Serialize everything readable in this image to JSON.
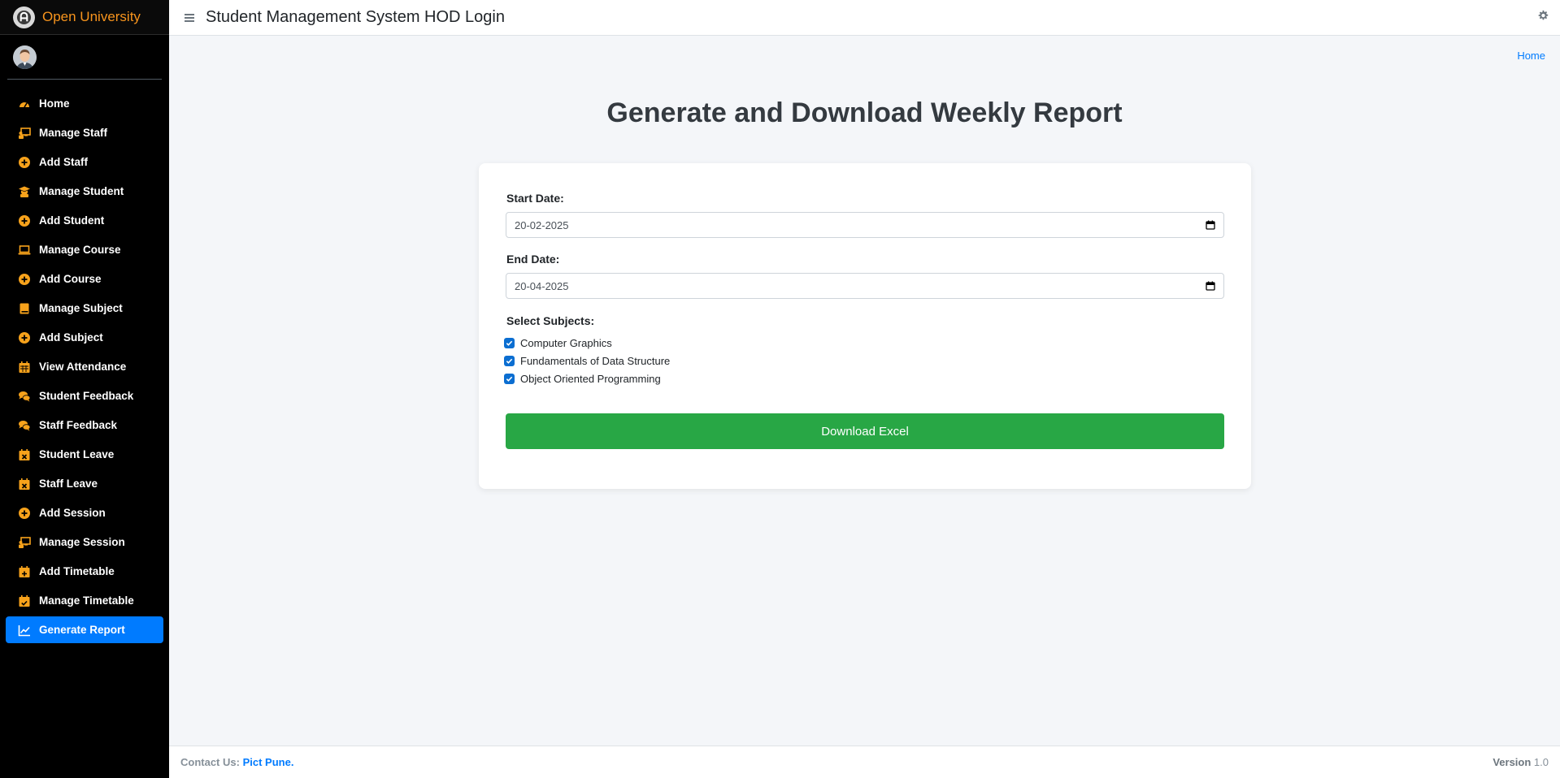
{
  "brand": {
    "name": "Open University"
  },
  "header": {
    "title": "Student Management System HOD Login"
  },
  "breadcrumb": {
    "home": "Home"
  },
  "sidebar": {
    "items": [
      {
        "label": "Home",
        "icon": "dashboard-icon"
      },
      {
        "label": "Manage Staff",
        "icon": "chalkboard-teacher-icon"
      },
      {
        "label": "Add Staff",
        "icon": "plus-circle-icon"
      },
      {
        "label": "Manage Student",
        "icon": "graduate-icon"
      },
      {
        "label": "Add Student",
        "icon": "plus-circle-icon"
      },
      {
        "label": "Manage Course",
        "icon": "laptop-icon"
      },
      {
        "label": "Add Course",
        "icon": "plus-circle-icon"
      },
      {
        "label": "Manage Subject",
        "icon": "book-icon"
      },
      {
        "label": "Add Subject",
        "icon": "plus-circle-icon"
      },
      {
        "label": "View Attendance",
        "icon": "calendar-icon"
      },
      {
        "label": "Student Feedback",
        "icon": "comments-icon"
      },
      {
        "label": "Staff Feedback",
        "icon": "comments-icon"
      },
      {
        "label": "Student Leave",
        "icon": "calendar-times-icon"
      },
      {
        "label": "Staff Leave",
        "icon": "calendar-times-icon"
      },
      {
        "label": "Add Session",
        "icon": "plus-circle-icon"
      },
      {
        "label": "Manage Session",
        "icon": "chalkboard-teacher-icon"
      },
      {
        "label": "Add Timetable",
        "icon": "calendar-plus-icon"
      },
      {
        "label": "Manage Timetable",
        "icon": "calendar-check-icon"
      },
      {
        "label": "Generate Report",
        "icon": "chart-line-icon",
        "active": true
      }
    ]
  },
  "main": {
    "heading": "Generate and Download Weekly Report",
    "start_date": {
      "label": "Start Date:",
      "value": "20-02-2025"
    },
    "end_date": {
      "label": "End Date:",
      "value": "20-04-2025"
    },
    "subjects": {
      "label": "Select Subjects:",
      "options": [
        {
          "label": "Computer Graphics",
          "checked": true
        },
        {
          "label": "Fundamentals of Data Structure",
          "checked": true
        },
        {
          "label": "Object Oriented Programming",
          "checked": true
        }
      ]
    },
    "download_label": "Download Excel"
  },
  "footer": {
    "contact_prefix": "Contact Us:",
    "contact_link": "Pict Pune.",
    "version_label": "Version",
    "version_number": "1.0"
  },
  "colors": {
    "sidebar_bg": "#000000",
    "brand_text": "#f7941d",
    "icon_orange": "#f7a21b",
    "active_item": "#007bff",
    "download_button": "#28a745",
    "checkbox": "#0b6ed1",
    "page_bg": "#f4f6f9"
  }
}
